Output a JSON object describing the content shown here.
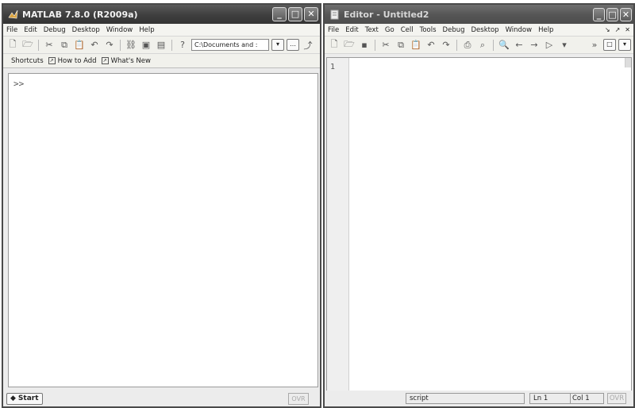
{
  "matlab": {
    "title": "MATLAB  7.8.0 (R2009a)",
    "menu": [
      "File",
      "Edit",
      "Debug",
      "Desktop",
      "Window",
      "Help"
    ],
    "current_directory": "C:\\Documents and :",
    "shortcuts": {
      "label": "Shortcuts",
      "how_to_add": "How to Add",
      "whats_new": "What's New"
    },
    "prompt": ">>",
    "status": {
      "start": "Start",
      "ovr": "OVR"
    }
  },
  "editor": {
    "title": "Editor - Untitled2",
    "menu": [
      "File",
      "Edit",
      "Text",
      "Go",
      "Cell",
      "Tools",
      "Debug",
      "Desktop",
      "Window",
      "Help"
    ],
    "line_number": "1",
    "status": {
      "mode": "script",
      "ln": "Ln  1",
      "col": "Col  1",
      "ovr": "OVR"
    }
  },
  "window_buttons": {
    "minimize": "_",
    "maximize": "□",
    "close": "✕"
  }
}
